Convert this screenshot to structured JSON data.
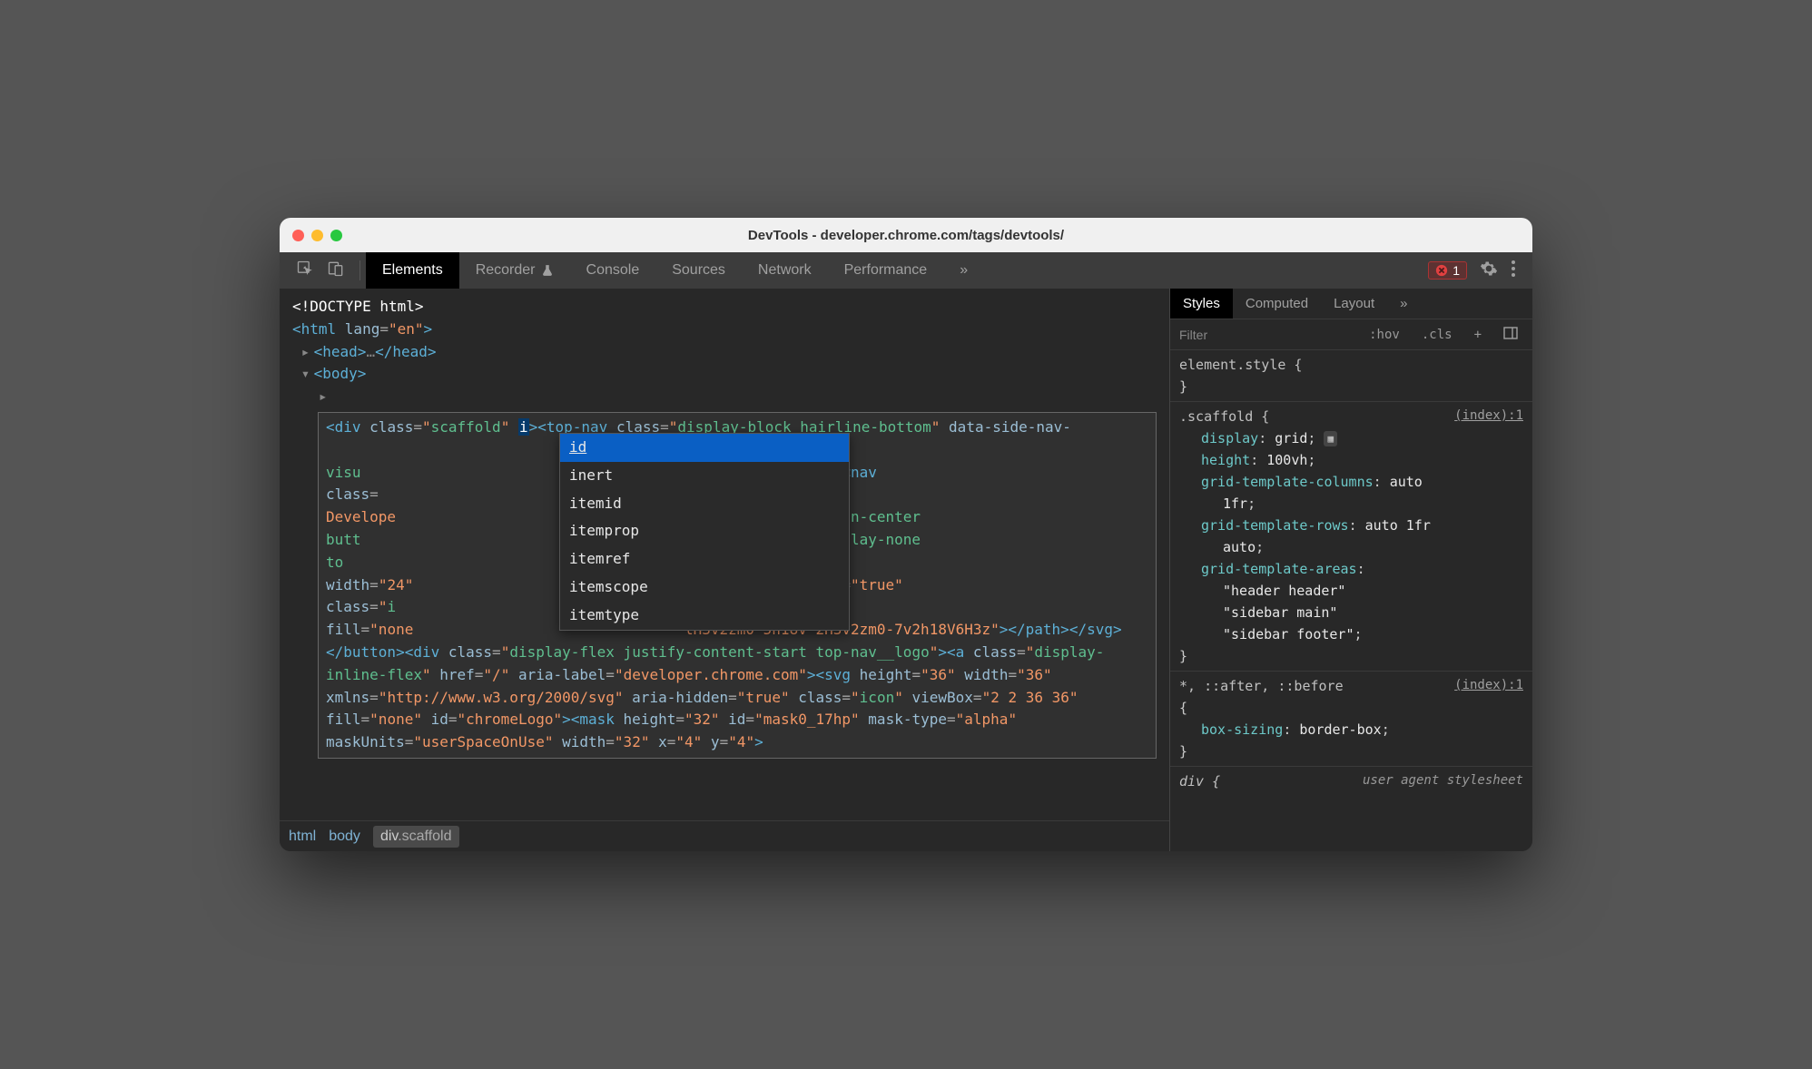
{
  "titlebar": "DevTools - developer.chrome.com/tags/devtools/",
  "tabs": {
    "elements": "Elements",
    "recorder": "Recorder",
    "console": "Console",
    "sources": "Sources",
    "network": "Network",
    "performance": "Performance"
  },
  "error_count": "1",
  "dom": {
    "doctype": "<!DOCTYPE html>",
    "html_open": "<html lang=\"en\">",
    "head": "<head>…</head>",
    "body": "<body>"
  },
  "editing_attr": "i",
  "autocomplete": [
    "id",
    "inert",
    "itemid",
    "itemprop",
    "itemref",
    "itemscope",
    "itemtype"
  ],
  "breadcrumb": {
    "html": "html",
    "body": "body",
    "div": "div",
    "scaffold": ".scaffold"
  },
  "styles_tabs": {
    "styles": "Styles",
    "computed": "Computed",
    "layout": "Layout"
  },
  "filter": {
    "placeholder": "Filter",
    "hov": ":hov",
    "cls": ".cls"
  },
  "rules": {
    "element_style": "element.style {",
    "scaffold_sel": ".scaffold {",
    "scaffold_src": "(index):1",
    "p1n": "display",
    "p1v": "grid",
    "p2n": "height",
    "p2v": "100vh",
    "p3n": "grid-template-columns",
    "p3v": "auto",
    "p3v2": "1fr",
    "p4n": "grid-template-rows",
    "p4v": "auto 1fr",
    "p4v2": "auto",
    "p5n": "grid-template-areas",
    "p5v1": "\"header header\"",
    "p5v2": "\"sidebar main\"",
    "p5v3": "\"sidebar footer\"",
    "universal_sel": "*, ::after, ::before",
    "universal_src": "(index):1",
    "p6n": "box-sizing",
    "p6v": "border-box",
    "div_sel": "div {",
    "ua": "user agent stylesheet"
  },
  "close_brace": "}"
}
